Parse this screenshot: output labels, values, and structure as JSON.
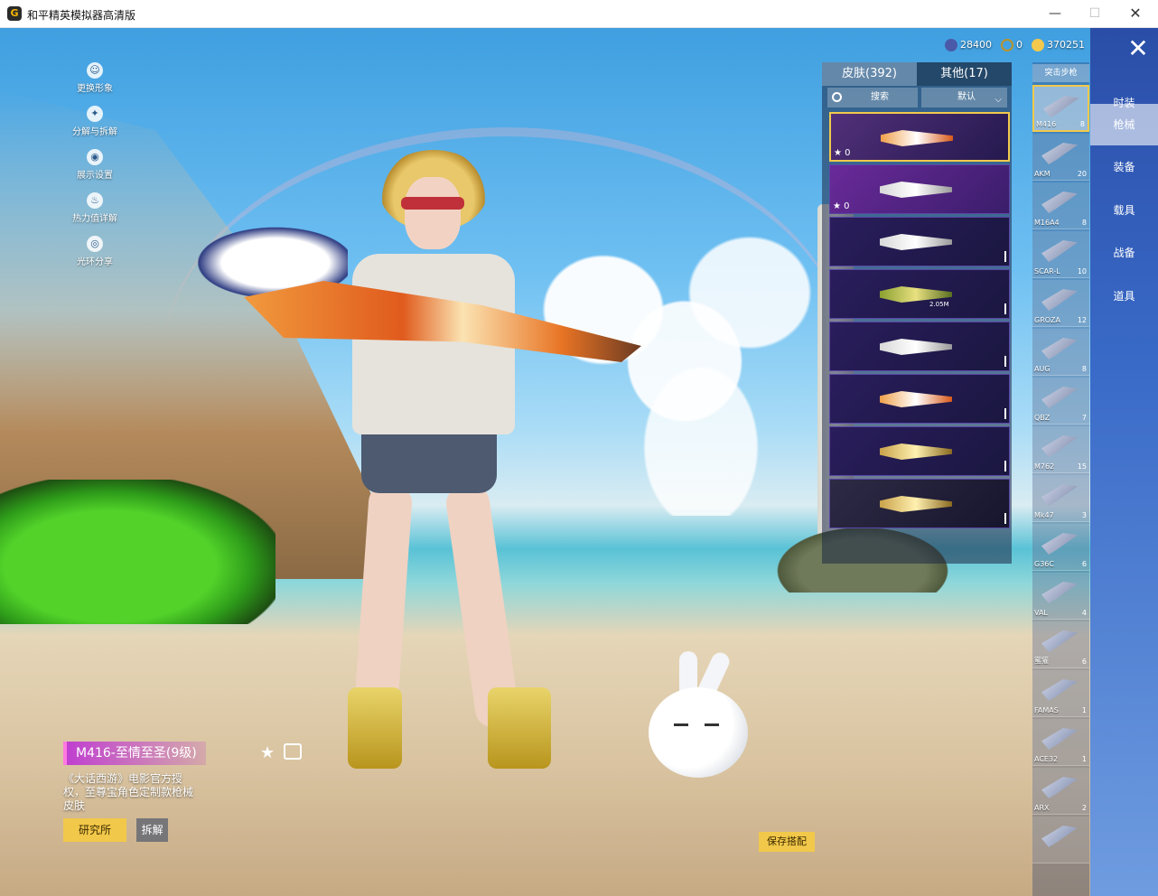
{
  "window": {
    "title": "和平精英模拟器高清版",
    "icon": "app-logo-icon",
    "minimize": "—",
    "maximize": "☐",
    "close": "✕"
  },
  "left_menu": [
    {
      "label": "更换形象",
      "icon": "avatar-icon"
    },
    {
      "label": "分解与拆解",
      "icon": "gear-icon"
    },
    {
      "label": "展示设置",
      "icon": "eye-icon"
    },
    {
      "label": "热力值详解",
      "icon": "fire-icon"
    },
    {
      "label": "光环分享",
      "icon": "halo-icon"
    }
  ],
  "currency": [
    {
      "value": "28400",
      "icon": "coin-blue-icon",
      "color": "#4a5aa8"
    },
    {
      "value": "0",
      "icon": "coin-gold-outline-icon",
      "color": "#b8942a"
    },
    {
      "value": "370251",
      "icon": "coin-gold-icon",
      "color": "#f2c94c"
    }
  ],
  "skin_panel": {
    "tabs": [
      {
        "label": "皮肤(392)"
      },
      {
        "label": "其他(17)"
      }
    ],
    "search_placeholder": "搜索",
    "sort_label": "默认",
    "items": [
      {
        "star": "★ 0",
        "variant": "orange"
      },
      {
        "star": "★ 0",
        "variant": "white"
      },
      {
        "star": "",
        "variant": "white"
      },
      {
        "star": "",
        "variant": "green",
        "tag": "2.05M"
      },
      {
        "star": "",
        "variant": "white"
      },
      {
        "star": "",
        "variant": "orange"
      },
      {
        "star": "",
        "variant": "gold"
      },
      {
        "star": "",
        "variant": "gold"
      }
    ]
  },
  "weapon_filter": "突击步枪",
  "weapons": [
    {
      "name": "M416",
      "count": "8"
    },
    {
      "name": "AKM",
      "count": "20"
    },
    {
      "name": "M16A4",
      "count": "8"
    },
    {
      "name": "SCAR-L",
      "count": "10"
    },
    {
      "name": "GROZA",
      "count": "12"
    },
    {
      "name": "AUG",
      "count": "8"
    },
    {
      "name": "QBZ",
      "count": "7"
    },
    {
      "name": "M762",
      "count": "15"
    },
    {
      "name": "Mk47",
      "count": "3"
    },
    {
      "name": "G36C",
      "count": "6"
    },
    {
      "name": "VAL",
      "count": "4"
    },
    {
      "name": "蜜獾",
      "count": "6"
    },
    {
      "name": "FAMAS",
      "count": "1"
    },
    {
      "name": "ACE32",
      "count": "1"
    },
    {
      "name": "ARX",
      "count": "2"
    },
    {
      "name": "",
      "count": ""
    }
  ],
  "categories": [
    "时装",
    "枪械",
    "装备",
    "载具",
    "战备",
    "道具"
  ],
  "close_label": "✕",
  "item_info": {
    "title": "M416-至情至圣(9级)",
    "description": "《大话西游》电影官方授权，至尊宝角色定制款枪械皮肤",
    "lab_button": "研究所",
    "dismantle_button": "拆解"
  },
  "save_button": "保存搭配",
  "colors": {
    "accent_yellow": "#f2c84a",
    "accent_blue": "#3a6bc8",
    "title_purple": "#c040d0"
  }
}
